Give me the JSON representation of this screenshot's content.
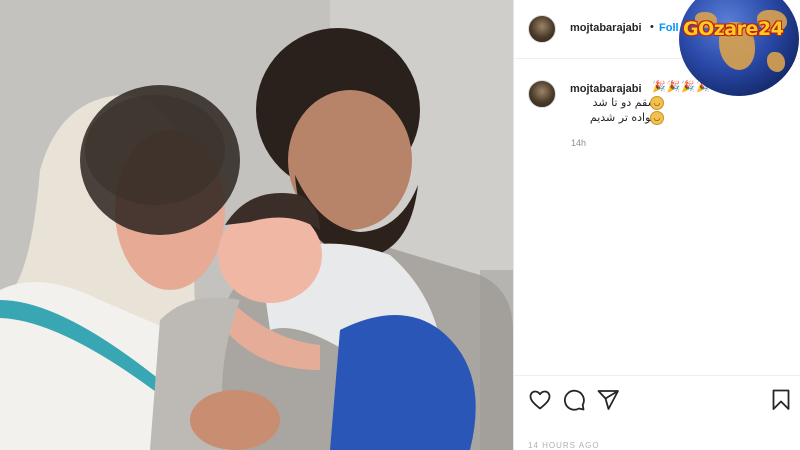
{
  "post": {
    "username": "mojtabarajabi",
    "separator": "•",
    "follow_label": "Foll",
    "caption": {
      "emoji_row": "🎉🎉🎉🎉",
      "line1": "عشقم دو تا شد",
      "line2": "خانواده تر شدیم",
      "emoji1": "😍",
      "emoji2": "😍"
    },
    "time": "14h",
    "bottom_text": "14 HOURS AGO"
  },
  "actions": {
    "like": "heart-icon",
    "comment": "comment-icon",
    "share": "share-icon",
    "save": "bookmark-icon"
  },
  "watermark": {
    "text": "GOzare24"
  },
  "colors": {
    "follow_blue": "#0095f6",
    "text_primary": "#262626",
    "text_secondary": "#8e8e8e",
    "watermark_yellow": "#ffcc22",
    "watermark_red": "#c4200c"
  }
}
